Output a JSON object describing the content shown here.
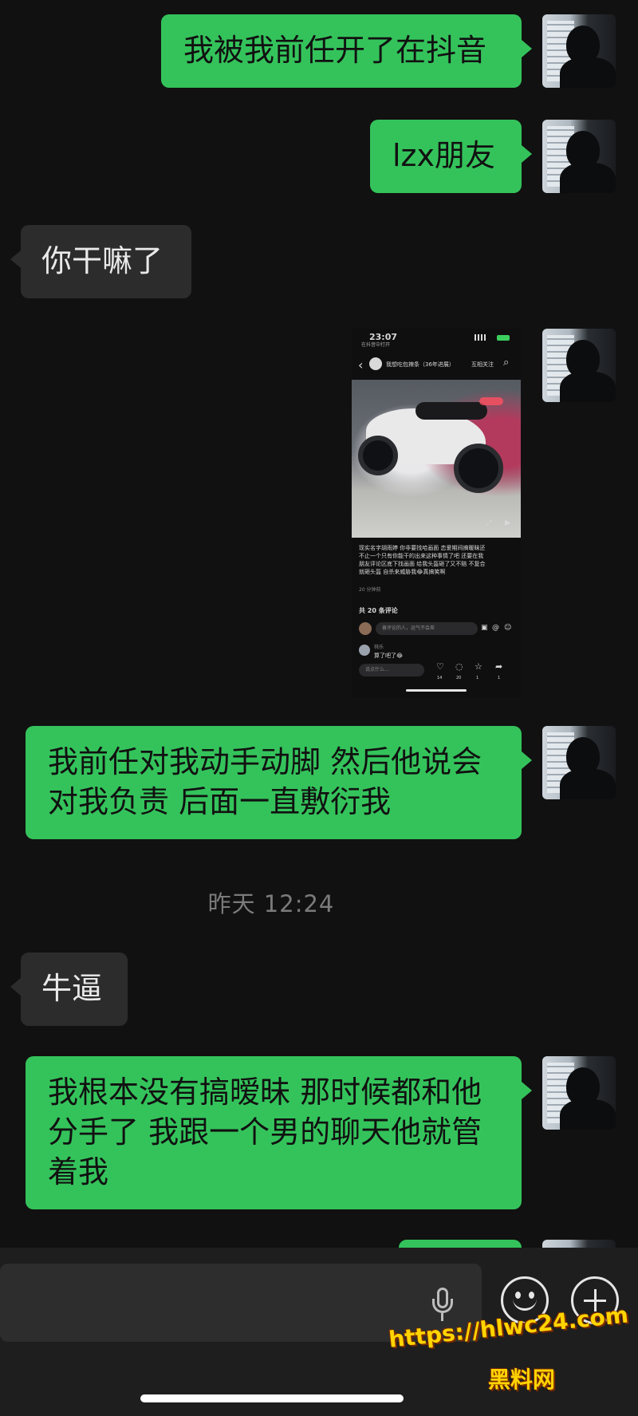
{
  "messages": [
    {
      "side": "out",
      "text": "我被我前任开了在抖音"
    },
    {
      "side": "out",
      "text": "lzx朋友"
    },
    {
      "side": "in",
      "text": "你干嘛了"
    },
    {
      "side": "out",
      "type": "image"
    },
    {
      "side": "out",
      "text_lines": [
        "我前任对我动手动脚 然后他说会",
        "对我负责 后面一直敷衍我"
      ]
    },
    {
      "side": "in",
      "text": "牛逼"
    },
    {
      "side": "out",
      "text_lines": [
        "我根本没有搞暧昧 那时候都和他",
        "分手了 我跟一个男的聊天他就管",
        "着我"
      ]
    }
  ],
  "timestamp": "昨天 12:24",
  "embedded_screenshot": {
    "time": "23:07",
    "back_label": "在抖音中打开",
    "account": "我想吃包辣条（36年进展）",
    "follow_label": "互相关注",
    "caption_lines": [
      "现实名字胡雨婷 你非要找哈画面 恋爱期间搞暧昧还",
      "不止一个只有你能干的出来这种事情了吧 还要在我",
      "朋友评论区底下找画面 给我头盔砸了又不赔 不复合",
      "就砸头盔 自杀来威胁我😂真搞笑啊"
    ],
    "time_ago": "20 分钟前",
    "comments_count": "共 20 条评论",
    "comment_placeholder": "善评论的人，运气不会差",
    "reply_user": "桃乐",
    "reply_text": "算了吧了😂",
    "say_placeholder": "说点什么…",
    "like_count": "14",
    "comment_count": "20",
    "fav_count": "1",
    "share_count": "1"
  },
  "watermark": {
    "line1": "https://hlwc24.com",
    "line2": "黑料网"
  },
  "colors": {
    "outgoing": "#34c35b",
    "incoming": "#2c2c2c",
    "background": "#111111",
    "watermark": "#ffd400"
  }
}
